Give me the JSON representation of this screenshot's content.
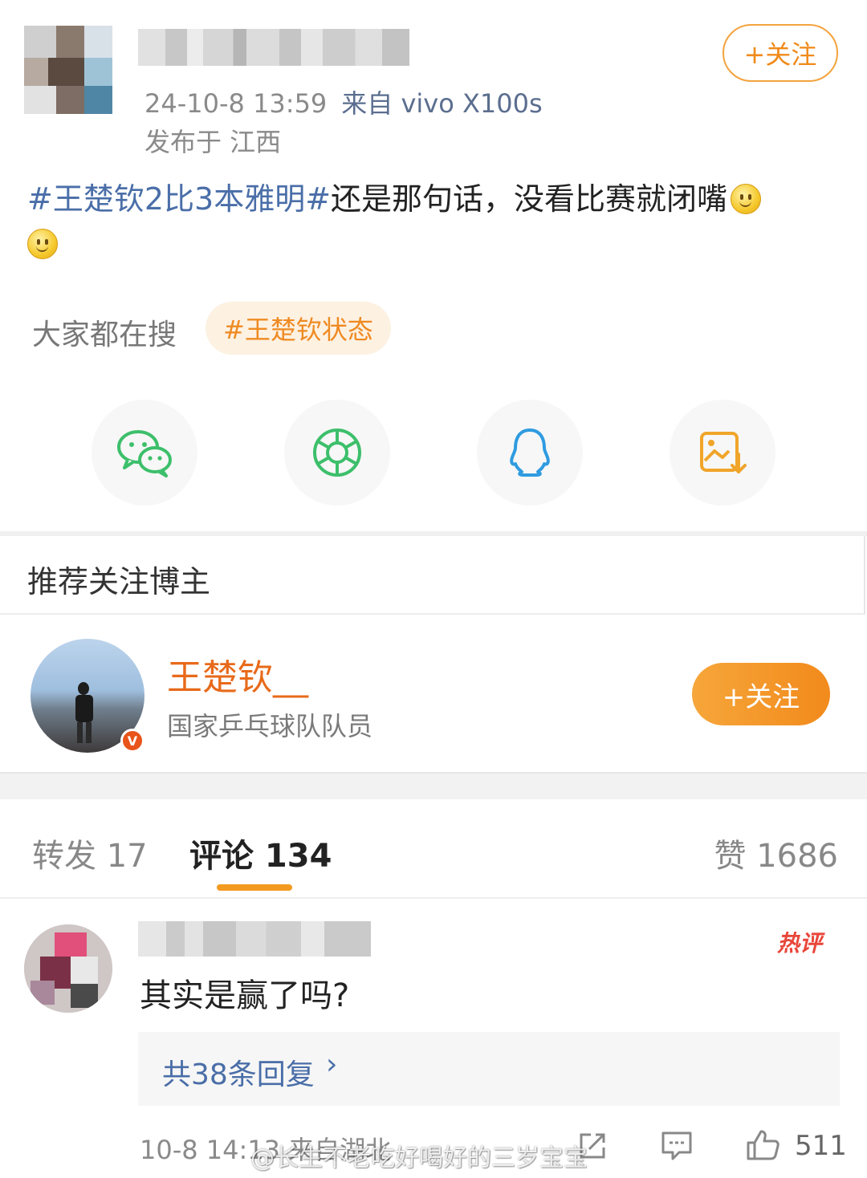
{
  "post": {
    "timestamp": "24-10-8 13:59",
    "source": "来自 vivo X100s",
    "location": "发布于 江西",
    "follow_label": "+关注",
    "hashtag": "#王楚钦2比3本雅明#",
    "text": "还是那句话，没看比赛就闭嘴",
    "emoji_icon": "smile-emoji"
  },
  "search": {
    "label": "大家都在搜",
    "chip": "#王楚钦状态"
  },
  "share": {
    "items": [
      "wechat-icon",
      "moments-icon",
      "qq-icon",
      "save-image-icon"
    ]
  },
  "recommend": {
    "title": "推荐关注博主",
    "name": "王楚钦__",
    "desc": "国家乒乓球队队员",
    "follow_label": "+关注",
    "badge": "V"
  },
  "tabs": {
    "repost": "转发 17",
    "comment": "评论 134",
    "like": "赞 1686"
  },
  "comment": {
    "hot_badge": "热评",
    "text": "其实是赢了吗?",
    "replies": "共38条回复",
    "reply_chevron": "›",
    "meta": "10-8 14:13 来自湖北",
    "likes": "511"
  },
  "watermark": "@长生不老吃好喝好的三岁宝宝",
  "colors": {
    "accent_orange": "#f28a1c",
    "link_blue": "#4a6ea8",
    "hot_red": "#e9463a"
  }
}
